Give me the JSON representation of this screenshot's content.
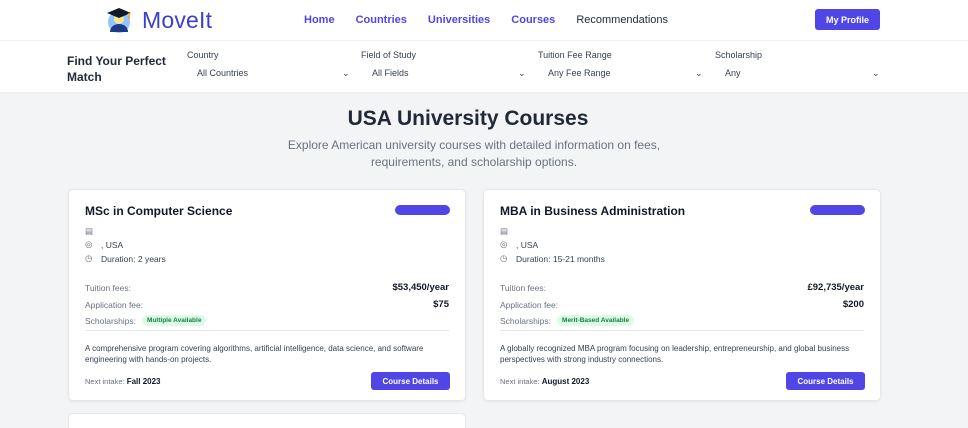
{
  "nav": {
    "logo_text": "MoveIt",
    "links": [
      "Home",
      "Countries",
      "Universities",
      "Courses",
      "Recommendations"
    ],
    "profile_label": "My Profile",
    "accent": "#4f46e5"
  },
  "filters": {
    "title": "Find Your Perfect Match",
    "country": {
      "label": "Country",
      "value": "All Countries"
    },
    "field": {
      "label": "Field of Study",
      "value": "All Fields"
    },
    "tuition": {
      "label": "Tuition Fee Range",
      "value": "Any Fee Range"
    },
    "scholarship": {
      "label": "Scholarship",
      "value": "Any"
    }
  },
  "hero": {
    "title": "USA University Courses",
    "subtitle": "Explore American university courses with detailed information on fees, requirements, and scholarship options."
  },
  "courses": [
    {
      "title": "MSc in Computer Science",
      "location": ", USA",
      "duration": "Duration: 2 years",
      "tuition_label": "Tuition fees:",
      "tuition": "$53,450/year",
      "app_fee_label": "Application fee:",
      "app_fee": "$75",
      "scholarship_label": "Scholarships:",
      "scholarship": "Multiple Available",
      "description": "A comprehensive program covering algorithms, artificial intelligence, data science, and software engineering with hands-on projects.",
      "intake_label": "Next intake:",
      "intake": "Fall 2023",
      "button": "Course Details"
    },
    {
      "title": "MBA in Business Administration",
      "location": ", USA",
      "duration": "Duration: 15-21 months",
      "tuition_label": "Tuition fees:",
      "tuition": "£92,735/year",
      "app_fee_label": "Application fee:",
      "app_fee": "$200",
      "scholarship_label": "Scholarships:",
      "scholarship": "Merit-Based Available",
      "description": "A globally recognized MBA program focusing on leadership, entrepreneurship, and global business perspectives with strong industry connections.",
      "intake_label": "Next intake:",
      "intake": "August 2023",
      "button": "Course Details"
    }
  ]
}
